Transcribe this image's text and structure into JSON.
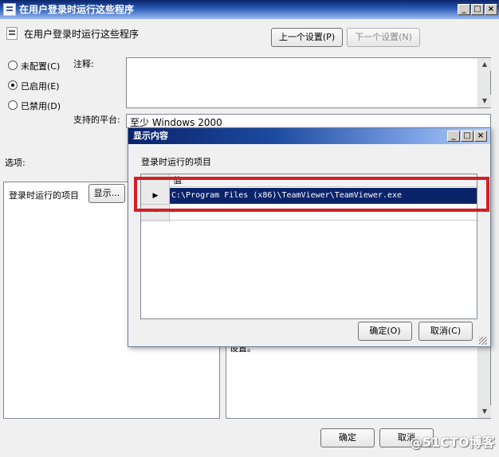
{
  "window": {
    "title": "在用户登录时运行这些程序",
    "caption_minimize": "_",
    "caption_maximize": "□",
    "caption_close": "×"
  },
  "header": {
    "setting_name": "在用户登录时运行这些程序",
    "prev_button": "上一个设置(P)",
    "next_button": "下一个设置(N)"
  },
  "state": {
    "not_configured": "未配置(C)",
    "enabled": "已启用(E)",
    "disabled": "已禁用(D)",
    "selected": "enabled"
  },
  "comment": {
    "label": "注释:",
    "value": ""
  },
  "platform": {
    "label": "支持的平台:",
    "value": "至少 Windows 2000"
  },
  "options": {
    "label": "选项:",
    "item_label": "登录时运行的项目",
    "show_button": "显示..."
  },
  "help_fragment": "设置。",
  "footer": {
    "ok_button": "确定",
    "cancel_button": "取消"
  },
  "dialog": {
    "title": "显示内容",
    "caption_minimize": "_",
    "caption_maximize": "□",
    "caption_close": "×",
    "list_label": "登录时运行的项目",
    "column_header": "值",
    "rows": [
      {
        "marker": "▶",
        "value": "C:\\Program Files (x86)\\TeamViewer\\TeamViewer.exe"
      },
      {
        "marker": "*",
        "value": ""
      }
    ],
    "ok_button": "确定(O)",
    "cancel_button": "取消(C)"
  },
  "watermark": "@51CTO博客"
}
